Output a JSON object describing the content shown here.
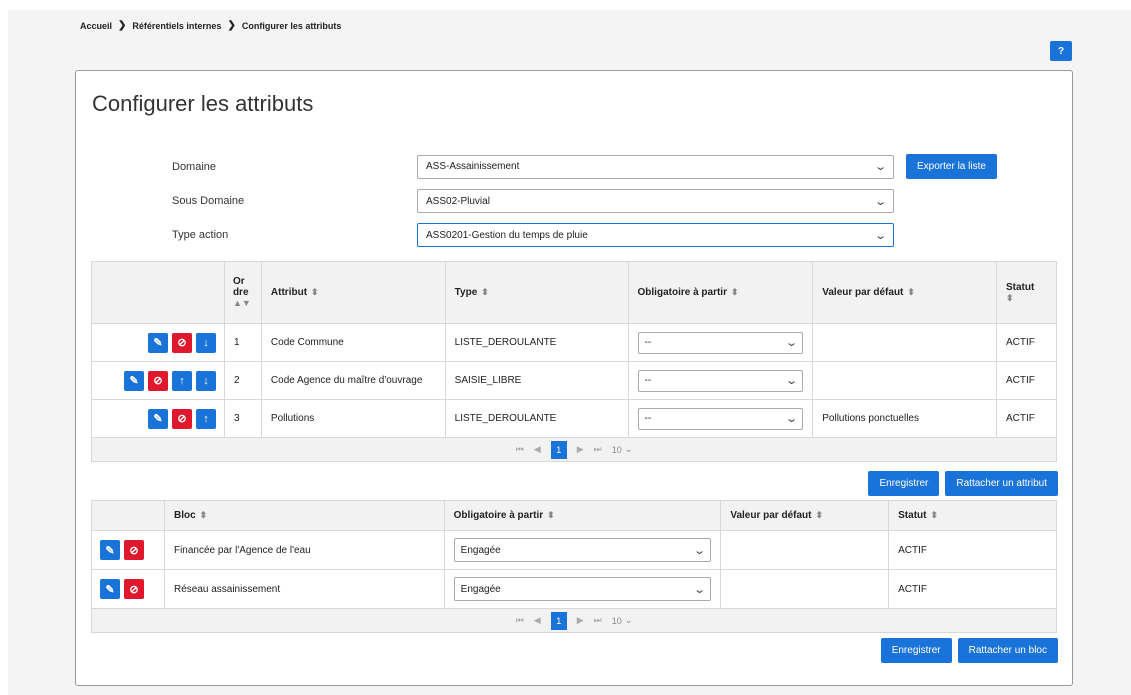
{
  "breadcrumb": {
    "items": [
      "Accueil",
      "Référentiels internes",
      "Configurer les attributs"
    ],
    "separator": "❯"
  },
  "help_label": "?",
  "page_title": "Configurer les attributs",
  "form": {
    "domaine": {
      "label": "Domaine",
      "value": "ASS-Assainissement"
    },
    "sous_domaine": {
      "label": "Sous Domaine",
      "value": "ASS02-Pluvial"
    },
    "type_action": {
      "label": "Type action",
      "value": "ASS0201-Gestion du temps de pluie"
    },
    "export_label": "Exporter la liste"
  },
  "attr_table": {
    "headers": {
      "ordre": "Or dre",
      "attribut": "Attribut",
      "type": "Type",
      "obligatoire": "Obligatoire à partir",
      "valeur": "Valeur par défaut",
      "statut": "Statut"
    },
    "rows": [
      {
        "ordre": "1",
        "attribut": "Code Commune",
        "type": "LISTE_DEROULANTE",
        "obligatoire": "--",
        "valeur": "",
        "statut": "ACTIF"
      },
      {
        "ordre": "2",
        "attribut": "Code Agence du maître d'ouvrage",
        "type": "SAISIE_LIBRE",
        "obligatoire": "--",
        "valeur": "",
        "statut": "ACTIF"
      },
      {
        "ordre": "3",
        "attribut": "Pollutions",
        "type": "LISTE_DEROULANTE",
        "obligatoire": "--",
        "valeur": "Pollutions ponctuelles",
        "statut": "ACTIF"
      }
    ],
    "pager": {
      "page": "1",
      "page_size": "10"
    },
    "save_label": "Enregistrer",
    "attach_label": "Rattacher un attribut"
  },
  "bloc_table": {
    "headers": {
      "bloc": "Bloc",
      "obligatoire": "Obligatoire à partir",
      "valeur": "Valeur par défaut",
      "statut": "Statut"
    },
    "rows": [
      {
        "bloc": "Financée par l'Agence de l'eau",
        "obligatoire": "Engagée",
        "valeur": "",
        "statut": "ACTIF"
      },
      {
        "bloc": "Réseau assainissement",
        "obligatoire": "Engagée",
        "valeur": "",
        "statut": "ACTIF"
      }
    ],
    "pager": {
      "page": "1",
      "page_size": "10"
    },
    "save_label": "Enregistrer",
    "attach_label": "Rattacher un bloc"
  },
  "colors": {
    "primary": "#1a73d9",
    "danger": "#e0182d",
    "header_bg": "#f2f2f2"
  }
}
